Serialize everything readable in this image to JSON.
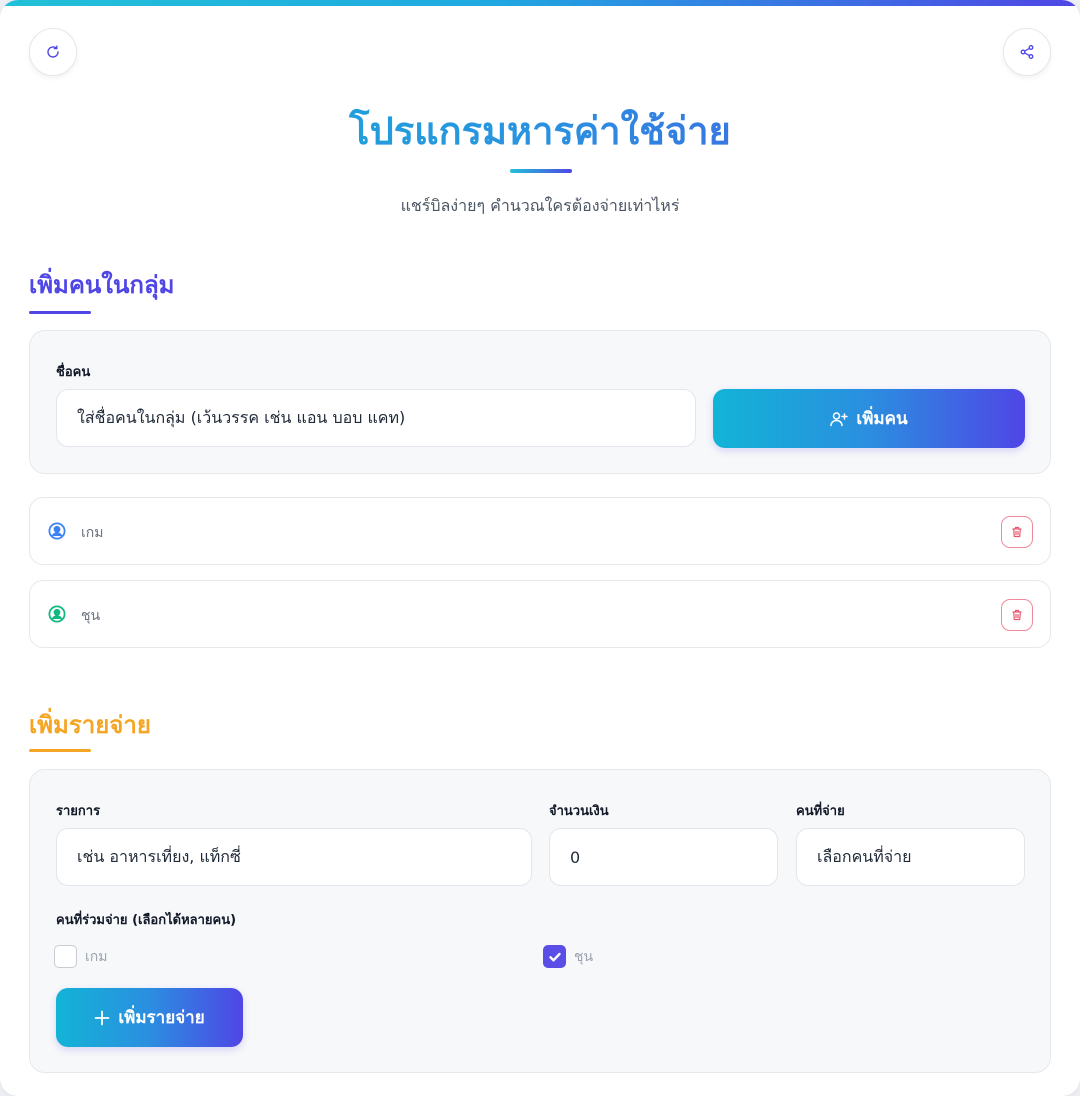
{
  "header": {
    "title": "โปรแกรมหารค่าใช้จ่าย",
    "subtitle": "แชร์บิลง่ายๆ คำนวณใครต้องจ่ายเท่าไหร่"
  },
  "people_section": {
    "title": "เพิ่มคนในกลุ่ม",
    "name_label": "ชื่อคน",
    "name_placeholder": "ใส่ชื่อคนในกลุ่ม (เว้นวรรค เช่น แอน บอบ แคท)",
    "add_button": "เพิ่มคน",
    "people": [
      {
        "name": "เกม",
        "icon": "user-circle-icon",
        "color": "#3b82f6"
      },
      {
        "name": "ชุน",
        "icon": "user-circle-icon",
        "color": "#10b981"
      }
    ]
  },
  "expense_section": {
    "title": "เพิ่มรายจ่าย",
    "item_label": "รายการ",
    "item_placeholder": "เช่น อาหารเที่ยง, แท็กซี่",
    "amount_label": "จำนวนเงิน",
    "amount_value": "0",
    "payer_label": "คนที่จ่าย",
    "payer_value": "เลือกคนที่จ่าย",
    "participants_label": "คนที่ร่วมจ่าย (เลือกได้หลายคน)",
    "participants": [
      {
        "name": "เกม",
        "checked": false
      },
      {
        "name": "ชุน",
        "checked": true
      }
    ],
    "add_button": "เพิ่มรายจ่าย"
  },
  "colors": {
    "accent_primary": "#4f46e5",
    "accent_cyan": "#12b4d6",
    "accent_orange": "#f5a524",
    "danger": "#f08a9a"
  }
}
